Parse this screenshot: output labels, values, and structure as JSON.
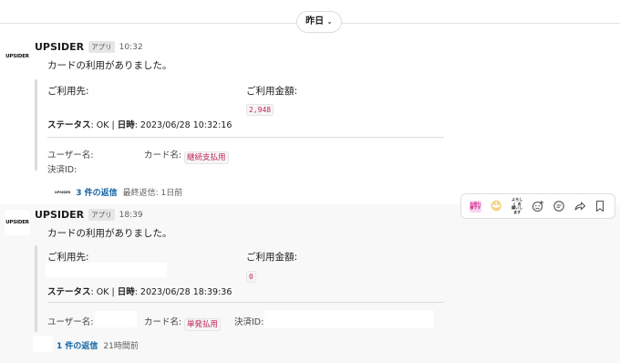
{
  "date_divider": {
    "label": "昨日",
    "chevron": "chevron-down-icon"
  },
  "messages": [
    {
      "avatar_text": "UPSIDER",
      "sender": "UPSIDER",
      "badge": "アプリ",
      "time": "10:32",
      "text": "カードの利用がありました。",
      "merchant_label": "ご利用先:",
      "amount_label": "ご利用金額:",
      "amount_value": "2,948",
      "status_label": "ステータス",
      "status_value": ": OK | ",
      "date_label": "日時",
      "date_value": ": 2023/06/28 10:32:16",
      "user_label": "ユーザー名:",
      "card_label": "カード名:",
      "card_value": "継続支払用",
      "payment_id_label": "決済ID:",
      "thread_avatar_text": "UPSIDER",
      "thread_link": "3 件の返信",
      "thread_meta": "最終返信: 1日前"
    },
    {
      "avatar_text": "UPSIDER",
      "sender": "UPSIDER",
      "badge": "アプリ",
      "time": "18:39",
      "text": "カードの利用がありました。",
      "merchant_label": "ご利用先:",
      "amount_label": "ご利用金額:",
      "amount_value": "0",
      "status_label": "ステータス",
      "status_value": ": OK | ",
      "date_label": "日時",
      "date_value": ": 2023/06/28 18:39:36",
      "user_label": "ユーザー名:",
      "card_label": "カード名:",
      "card_value": "単発払用",
      "payment_id_label": "決済ID:",
      "thread_link": "1 件の返信",
      "thread_meta": "21時間前"
    }
  ],
  "hover_actions": [
    {
      "name": "reaction-otsukare-emoji",
      "text": "お疲れ様です",
      "bg": "#f7d4f0",
      "fg": "#d6238a"
    },
    {
      "name": "reaction-smile-emoji",
      "text": "😊",
      "bg": "#ffffff",
      "fg": "#e8a600"
    },
    {
      "name": "reaction-yoroshiku-emoji",
      "text": "よろしく お願いします",
      "bg": "#ffffff",
      "fg": "#222222"
    },
    {
      "name": "add-reaction-icon",
      "text": "☺+"
    },
    {
      "name": "reply-in-thread-icon",
      "text": "💬"
    },
    {
      "name": "forward-icon",
      "text": "➦"
    },
    {
      "name": "save-bookmark-icon",
      "text": "🔖"
    }
  ],
  "colors": {
    "link": "#1264a3",
    "code_text": "#c0245c",
    "highlight_bg": "#f8f8f8"
  }
}
